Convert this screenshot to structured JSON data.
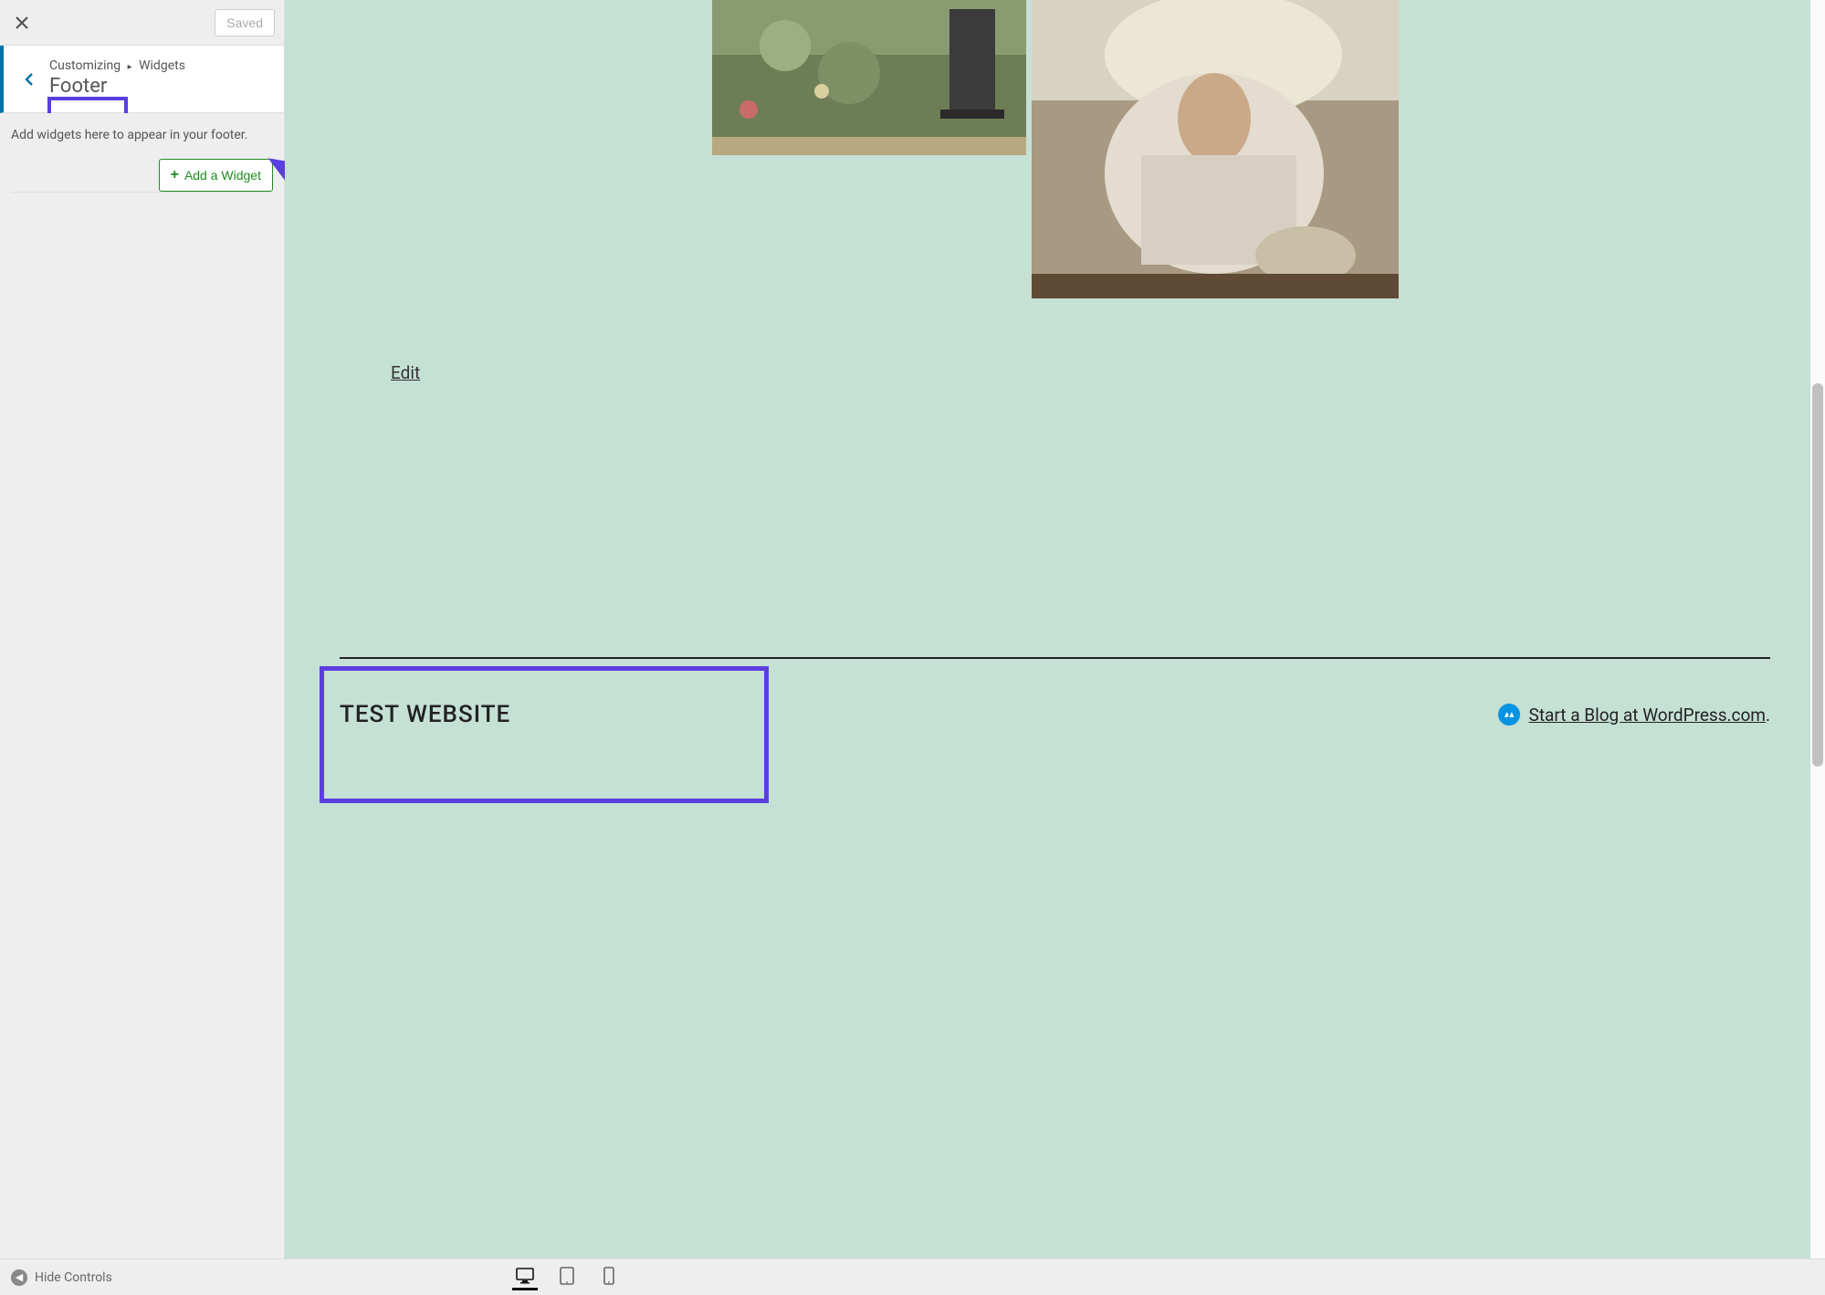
{
  "sidebar": {
    "saved_label": "Saved",
    "breadcrumb_prefix": "Customizing",
    "breadcrumb_parent": "Widgets",
    "section_title": "Footer",
    "helper_text": "Add widgets here to appear in your footer.",
    "add_widget_label": "Add a Widget"
  },
  "preview": {
    "edit_link": "Edit",
    "site_title": "TEST WEBSITE",
    "wp_credit_text": "Start a Blog at WordPress.com",
    "wp_credit_suffix": "."
  },
  "bottombar": {
    "hide_controls": "Hide Controls"
  }
}
